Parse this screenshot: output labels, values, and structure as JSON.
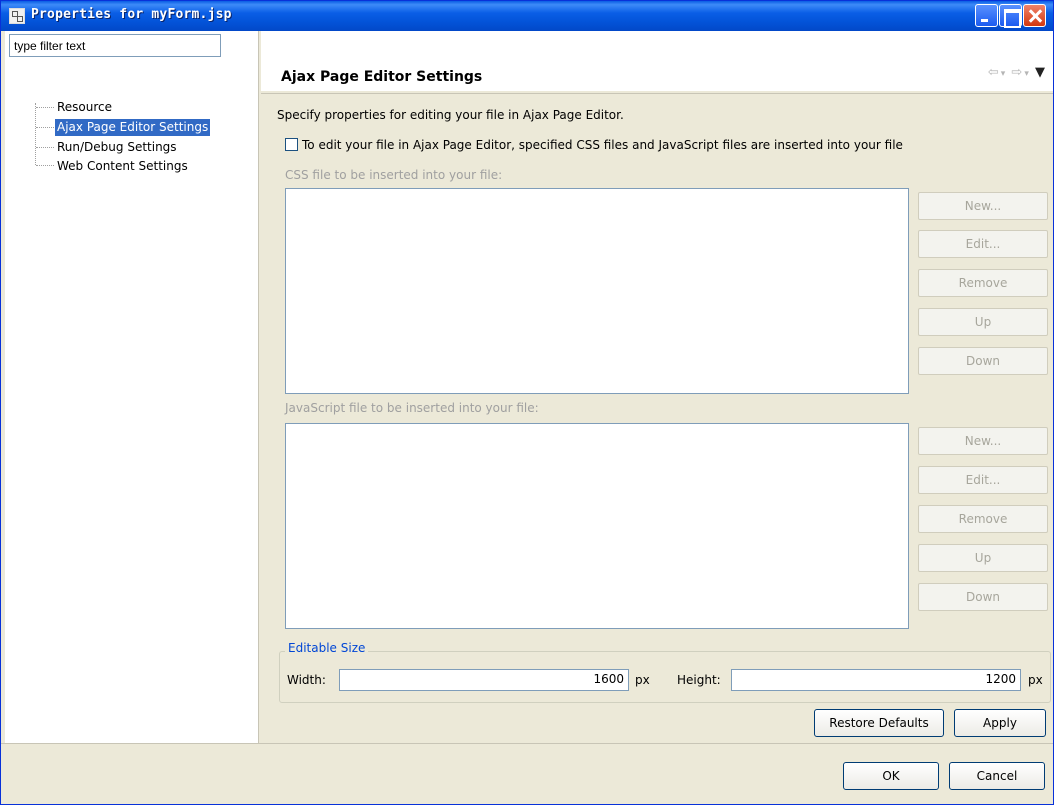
{
  "window": {
    "title": "Properties for myForm.jsp"
  },
  "sidebar": {
    "filter_placeholder": "type filter text",
    "items": [
      {
        "label": "Resource",
        "selected": false
      },
      {
        "label": "Ajax Page Editor Settings",
        "selected": true
      },
      {
        "label": "Run/Debug Settings",
        "selected": false
      },
      {
        "label": "Web Content Settings",
        "selected": false
      }
    ]
  },
  "page": {
    "title": "Ajax Page Editor Settings",
    "description": "Specify properties for editing your file in Ajax Page Editor.",
    "checkbox_label": "To edit your file in Ajax Page Editor, specified CSS files and JavaScript files are inserted into your file",
    "checkbox_checked": false,
    "css_section": {
      "label": "CSS file to be inserted into your file:",
      "buttons": [
        "New...",
        "Edit...",
        "Remove",
        "Up",
        "Down"
      ]
    },
    "js_section": {
      "label": "JavaScript file to be inserted into your file:",
      "buttons": [
        "New...",
        "Edit...",
        "Remove",
        "Up",
        "Down"
      ]
    },
    "editable_size": {
      "title": "Editable Size",
      "width_label": "Width:",
      "width_value": "1600",
      "height_label": "Height:",
      "height_value": "1200",
      "unit": "px"
    },
    "restore_defaults": "Restore Defaults",
    "apply": "Apply"
  },
  "footer": {
    "ok": "OK",
    "cancel": "Cancel"
  },
  "nav_icons": [
    "back-arrow-icon",
    "dropdown-icon",
    "forward-arrow-icon",
    "dropdown-icon",
    "view-menu-icon"
  ]
}
